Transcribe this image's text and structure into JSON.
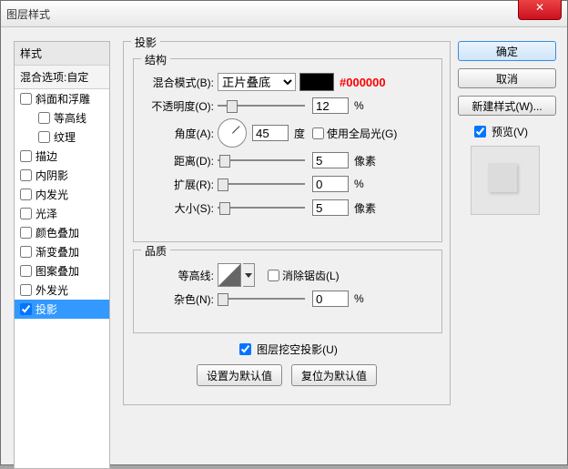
{
  "window": {
    "title": "图层样式"
  },
  "sidebar": {
    "header": "样式",
    "blend_opts": "混合选项:自定",
    "items": [
      {
        "label": "斜面和浮雕",
        "checked": false,
        "indent": 0
      },
      {
        "label": "等高线",
        "checked": false,
        "indent": 1
      },
      {
        "label": "纹理",
        "checked": false,
        "indent": 1
      },
      {
        "label": "描边",
        "checked": false,
        "indent": 0
      },
      {
        "label": "内阴影",
        "checked": false,
        "indent": 0
      },
      {
        "label": "内发光",
        "checked": false,
        "indent": 0
      },
      {
        "label": "光泽",
        "checked": false,
        "indent": 0
      },
      {
        "label": "颜色叠加",
        "checked": false,
        "indent": 0
      },
      {
        "label": "渐变叠加",
        "checked": false,
        "indent": 0
      },
      {
        "label": "图案叠加",
        "checked": false,
        "indent": 0
      },
      {
        "label": "外发光",
        "checked": false,
        "indent": 0
      },
      {
        "label": "投影",
        "checked": true,
        "indent": 0,
        "selected": true
      }
    ]
  },
  "main": {
    "title": "投影",
    "structure": {
      "legend": "结构",
      "blend_mode_label": "混合模式(B):",
      "blend_mode_value": "正片叠底",
      "color": "#000000",
      "hex_label": "#000000",
      "opacity_label": "不透明度(O):",
      "opacity_value": "12",
      "opacity_unit": "%",
      "angle_label": "角度(A):",
      "angle_value": "45",
      "angle_unit": "度",
      "global_light_label": "使用全局光(G)",
      "global_light_checked": false,
      "distance_label": "距离(D):",
      "distance_value": "5",
      "distance_unit": "像素",
      "spread_label": "扩展(R):",
      "spread_value": "0",
      "spread_unit": "%",
      "size_label": "大小(S):",
      "size_value": "5",
      "size_unit": "像素"
    },
    "quality": {
      "legend": "品质",
      "contour_label": "等高线:",
      "antialias_label": "消除锯齿(L)",
      "antialias_checked": false,
      "noise_label": "杂色(N):",
      "noise_value": "0",
      "noise_unit": "%"
    },
    "knockout_label": "图层挖空投影(U)",
    "knockout_checked": true,
    "btn_default": "设置为默认值",
    "btn_reset": "复位为默认值"
  },
  "right": {
    "ok": "确定",
    "cancel": "取消",
    "new_style": "新建样式(W)...",
    "preview_label": "预览(V)",
    "preview_checked": true
  }
}
